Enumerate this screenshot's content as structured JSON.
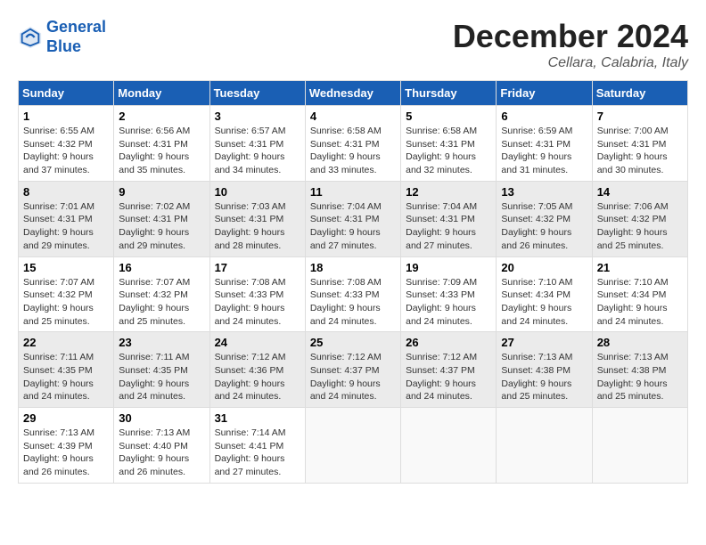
{
  "header": {
    "logo_line1": "General",
    "logo_line2": "Blue",
    "month_title": "December 2024",
    "location": "Cellara, Calabria, Italy"
  },
  "weekdays": [
    "Sunday",
    "Monday",
    "Tuesday",
    "Wednesday",
    "Thursday",
    "Friday",
    "Saturday"
  ],
  "weeks": [
    [
      {
        "day": "1",
        "sunrise": "Sunrise: 6:55 AM",
        "sunset": "Sunset: 4:32 PM",
        "daylight": "Daylight: 9 hours and 37 minutes."
      },
      {
        "day": "2",
        "sunrise": "Sunrise: 6:56 AM",
        "sunset": "Sunset: 4:31 PM",
        "daylight": "Daylight: 9 hours and 35 minutes."
      },
      {
        "day": "3",
        "sunrise": "Sunrise: 6:57 AM",
        "sunset": "Sunset: 4:31 PM",
        "daylight": "Daylight: 9 hours and 34 minutes."
      },
      {
        "day": "4",
        "sunrise": "Sunrise: 6:58 AM",
        "sunset": "Sunset: 4:31 PM",
        "daylight": "Daylight: 9 hours and 33 minutes."
      },
      {
        "day": "5",
        "sunrise": "Sunrise: 6:58 AM",
        "sunset": "Sunset: 4:31 PM",
        "daylight": "Daylight: 9 hours and 32 minutes."
      },
      {
        "day": "6",
        "sunrise": "Sunrise: 6:59 AM",
        "sunset": "Sunset: 4:31 PM",
        "daylight": "Daylight: 9 hours and 31 minutes."
      },
      {
        "day": "7",
        "sunrise": "Sunrise: 7:00 AM",
        "sunset": "Sunset: 4:31 PM",
        "daylight": "Daylight: 9 hours and 30 minutes."
      }
    ],
    [
      {
        "day": "8",
        "sunrise": "Sunrise: 7:01 AM",
        "sunset": "Sunset: 4:31 PM",
        "daylight": "Daylight: 9 hours and 29 minutes."
      },
      {
        "day": "9",
        "sunrise": "Sunrise: 7:02 AM",
        "sunset": "Sunset: 4:31 PM",
        "daylight": "Daylight: 9 hours and 29 minutes."
      },
      {
        "day": "10",
        "sunrise": "Sunrise: 7:03 AM",
        "sunset": "Sunset: 4:31 PM",
        "daylight": "Daylight: 9 hours and 28 minutes."
      },
      {
        "day": "11",
        "sunrise": "Sunrise: 7:04 AM",
        "sunset": "Sunset: 4:31 PM",
        "daylight": "Daylight: 9 hours and 27 minutes."
      },
      {
        "day": "12",
        "sunrise": "Sunrise: 7:04 AM",
        "sunset": "Sunset: 4:31 PM",
        "daylight": "Daylight: 9 hours and 27 minutes."
      },
      {
        "day": "13",
        "sunrise": "Sunrise: 7:05 AM",
        "sunset": "Sunset: 4:32 PM",
        "daylight": "Daylight: 9 hours and 26 minutes."
      },
      {
        "day": "14",
        "sunrise": "Sunrise: 7:06 AM",
        "sunset": "Sunset: 4:32 PM",
        "daylight": "Daylight: 9 hours and 25 minutes."
      }
    ],
    [
      {
        "day": "15",
        "sunrise": "Sunrise: 7:07 AM",
        "sunset": "Sunset: 4:32 PM",
        "daylight": "Daylight: 9 hours and 25 minutes."
      },
      {
        "day": "16",
        "sunrise": "Sunrise: 7:07 AM",
        "sunset": "Sunset: 4:32 PM",
        "daylight": "Daylight: 9 hours and 25 minutes."
      },
      {
        "day": "17",
        "sunrise": "Sunrise: 7:08 AM",
        "sunset": "Sunset: 4:33 PM",
        "daylight": "Daylight: 9 hours and 24 minutes."
      },
      {
        "day": "18",
        "sunrise": "Sunrise: 7:08 AM",
        "sunset": "Sunset: 4:33 PM",
        "daylight": "Daylight: 9 hours and 24 minutes."
      },
      {
        "day": "19",
        "sunrise": "Sunrise: 7:09 AM",
        "sunset": "Sunset: 4:33 PM",
        "daylight": "Daylight: 9 hours and 24 minutes."
      },
      {
        "day": "20",
        "sunrise": "Sunrise: 7:10 AM",
        "sunset": "Sunset: 4:34 PM",
        "daylight": "Daylight: 9 hours and 24 minutes."
      },
      {
        "day": "21",
        "sunrise": "Sunrise: 7:10 AM",
        "sunset": "Sunset: 4:34 PM",
        "daylight": "Daylight: 9 hours and 24 minutes."
      }
    ],
    [
      {
        "day": "22",
        "sunrise": "Sunrise: 7:11 AM",
        "sunset": "Sunset: 4:35 PM",
        "daylight": "Daylight: 9 hours and 24 minutes."
      },
      {
        "day": "23",
        "sunrise": "Sunrise: 7:11 AM",
        "sunset": "Sunset: 4:35 PM",
        "daylight": "Daylight: 9 hours and 24 minutes."
      },
      {
        "day": "24",
        "sunrise": "Sunrise: 7:12 AM",
        "sunset": "Sunset: 4:36 PM",
        "daylight": "Daylight: 9 hours and 24 minutes."
      },
      {
        "day": "25",
        "sunrise": "Sunrise: 7:12 AM",
        "sunset": "Sunset: 4:37 PM",
        "daylight": "Daylight: 9 hours and 24 minutes."
      },
      {
        "day": "26",
        "sunrise": "Sunrise: 7:12 AM",
        "sunset": "Sunset: 4:37 PM",
        "daylight": "Daylight: 9 hours and 24 minutes."
      },
      {
        "day": "27",
        "sunrise": "Sunrise: 7:13 AM",
        "sunset": "Sunset: 4:38 PM",
        "daylight": "Daylight: 9 hours and 25 minutes."
      },
      {
        "day": "28",
        "sunrise": "Sunrise: 7:13 AM",
        "sunset": "Sunset: 4:38 PM",
        "daylight": "Daylight: 9 hours and 25 minutes."
      }
    ],
    [
      {
        "day": "29",
        "sunrise": "Sunrise: 7:13 AM",
        "sunset": "Sunset: 4:39 PM",
        "daylight": "Daylight: 9 hours and 26 minutes."
      },
      {
        "day": "30",
        "sunrise": "Sunrise: 7:13 AM",
        "sunset": "Sunset: 4:40 PM",
        "daylight": "Daylight: 9 hours and 26 minutes."
      },
      {
        "day": "31",
        "sunrise": "Sunrise: 7:14 AM",
        "sunset": "Sunset: 4:41 PM",
        "daylight": "Daylight: 9 hours and 27 minutes."
      },
      null,
      null,
      null,
      null
    ]
  ]
}
